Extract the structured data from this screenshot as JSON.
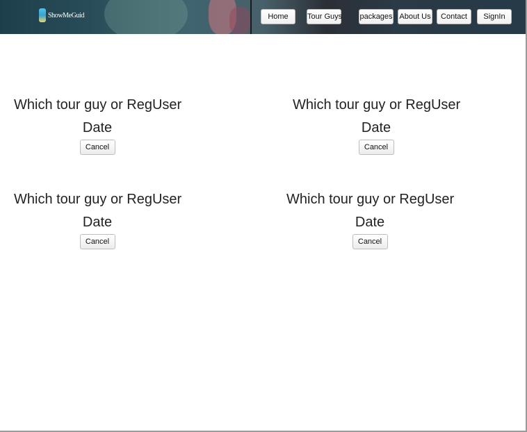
{
  "header": {
    "logo_text": "ShowMeGuid",
    "nav": [
      {
        "label": "Home"
      },
      {
        "label": "Tour Guys"
      },
      {
        "label": "packages"
      },
      {
        "label": "About Us"
      },
      {
        "label": "Contact"
      },
      {
        "label": "SignIn"
      }
    ]
  },
  "bookings": [
    {
      "who": "Which tour guy or RegUser",
      "date": "Date",
      "cancel_label": "Cancel"
    },
    {
      "who": "Which tour guy or RegUser",
      "date": "Date",
      "cancel_label": "Cancel"
    },
    {
      "who": "Which tour guy or RegUser",
      "date": "Date",
      "cancel_label": "Cancel"
    },
    {
      "who": "Which tour guy or RegUser",
      "date": "Date",
      "cancel_label": "Cancel"
    }
  ]
}
